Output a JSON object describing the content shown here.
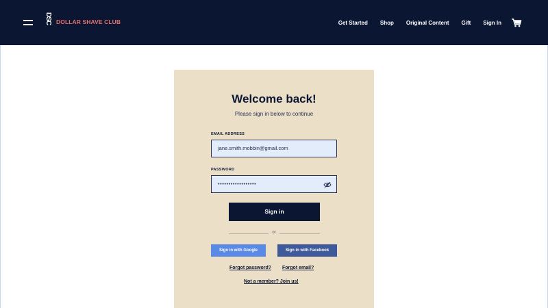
{
  "header": {
    "logo_mark": "DSC",
    "logo_text": "DOLLAR SHAVE CLUB",
    "nav": [
      "Get Started",
      "Shop",
      "Original Content",
      "Gift",
      "Sign In"
    ],
    "menu_icon": "hamburger-icon",
    "cart_icon": "cart-icon"
  },
  "form": {
    "title": "Welcome back!",
    "subtitle": "Please sign in below to continue",
    "email_label": "EMAIL ADDRESS",
    "email_value": "jane.smith.mobbin@gmail.com",
    "password_label": "PASSWORD",
    "password_value": "••••••••••••••••••",
    "password_toggle_icon": "eye-off-icon",
    "signin_label": "Sign in",
    "or_label": "or",
    "google_label": "Sign in with Google",
    "facebook_label": "Sign in with Facebook",
    "forgot_password": "Forgot password?",
    "forgot_email": "Forgot email?",
    "join": "Not a member? Join us!"
  },
  "colors": {
    "header_bg": "#0b1633",
    "brand_accent": "#e8706a",
    "card_bg": "#ebdfc8",
    "input_bg": "#e2ecfb",
    "google": "#5b8ae6",
    "facebook": "#3f5a9a"
  }
}
